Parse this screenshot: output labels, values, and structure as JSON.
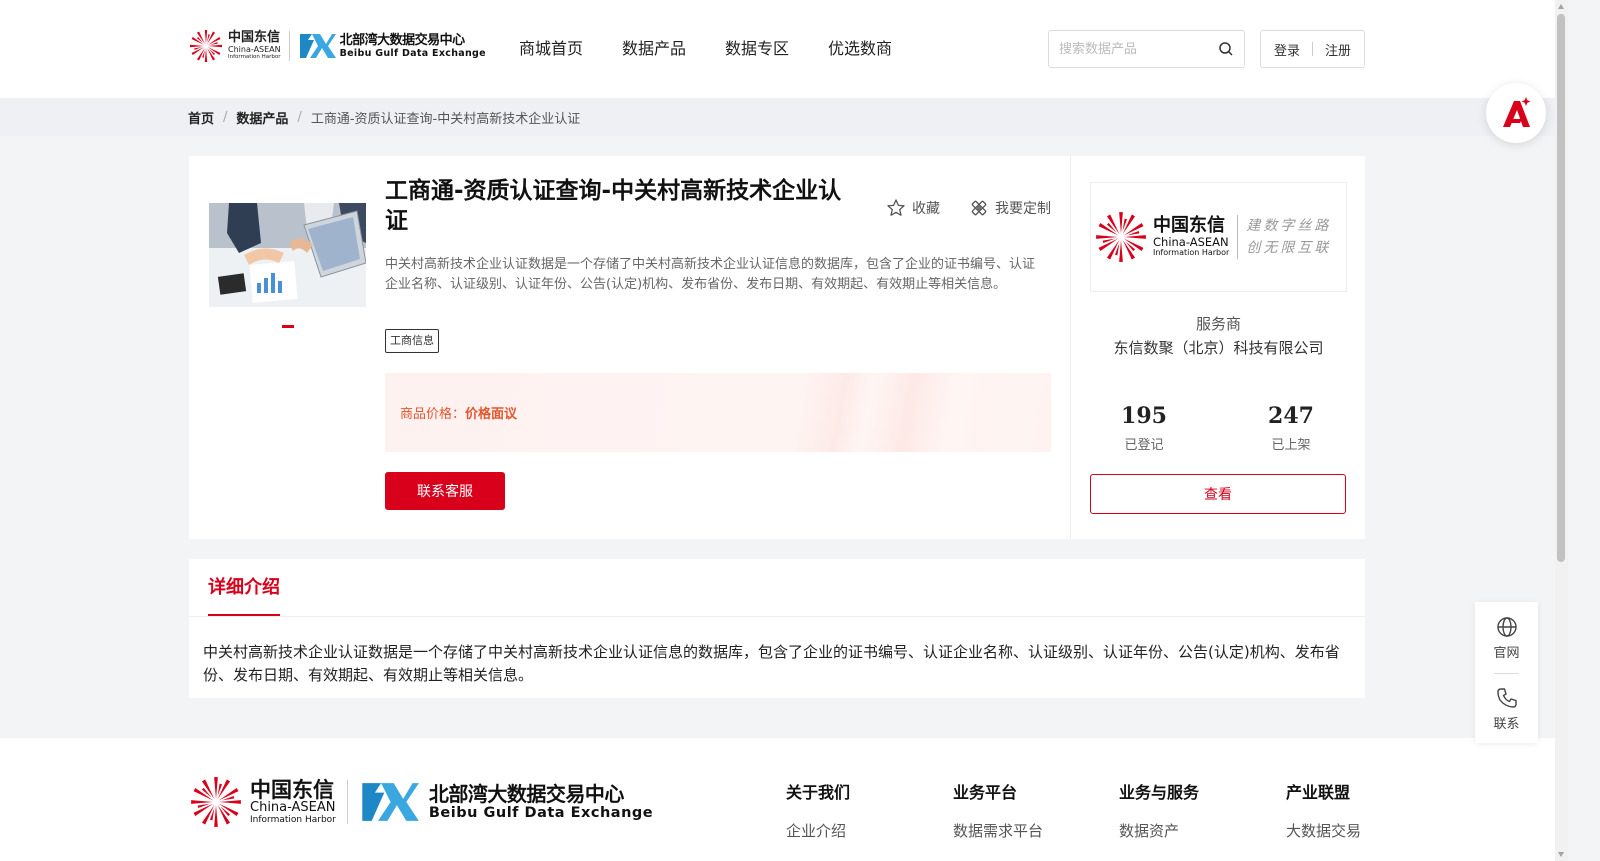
{
  "header": {
    "logo_ct": {
      "cn": "中国东信",
      "en1": "China-ASEAN",
      "en2": "Information Harbor"
    },
    "logo_bb": {
      "cn": "北部湾大数据交易中心",
      "en": "Beibu Gulf Data Exchange"
    },
    "nav": [
      "商城首页",
      "数据产品",
      "数据专区",
      "优选数商"
    ],
    "search_placeholder": "搜索数据产品",
    "login": "登录",
    "register": "注册"
  },
  "breadcrumb": {
    "home": "首页",
    "section": "数据产品",
    "current": "工商通-资质认证查询-中关村高新技术企业认证"
  },
  "product": {
    "title": "工商通-资质认证查询-中关村高新技术企业认证",
    "favorite": "收藏",
    "customize": "我要定制",
    "description": "中关村高新技术企业认证数据是一个存储了中关村高新技术企业认证信息的数据库，包含了企业的证书编号、认证企业名称、认证级别、认证年份、公告(认定)机构、发布省份、发布日期、有效期起、有效期止等相关信息。",
    "tag": "工商信息",
    "price_label": "商品价格：",
    "price_value": "价格面议",
    "contact_button": "联系客服"
  },
  "vendor": {
    "logo_cn": "中国东信",
    "logo_en1": "China-ASEAN",
    "logo_en2": "Information Harbor",
    "slogan1": "建数字丝路",
    "slogan2": "创无限互联",
    "label": "服务商",
    "name": "东信数聚（北京）科技有限公司",
    "stats": [
      {
        "num": "195",
        "label": "已登记"
      },
      {
        "num": "247",
        "label": "已上架"
      }
    ],
    "view_button": "查看"
  },
  "detail": {
    "tab": "详细介绍",
    "text": "中关村高新技术企业认证数据是一个存储了中关村高新技术企业认证信息的数据库，包含了企业的证书编号、认证企业名称、认证级别、认证年份、公告(认定)机构、发布省份、发布日期、有效期起、有效期止等相关信息。"
  },
  "footer": {
    "logo_ct": {
      "cn": "中国东信",
      "en1": "China-ASEAN",
      "en2": "Information Harbor"
    },
    "logo_bb": {
      "cn": "北部湾大数据交易中心",
      "en": "Beibu Gulf Data Exchange"
    },
    "columns": [
      {
        "title": "关于我们",
        "item": "企业介绍"
      },
      {
        "title": "业务平台",
        "item": "数据需求平台"
      },
      {
        "title": "业务与服务",
        "item": "数据资产"
      },
      {
        "title": "产业联盟",
        "item": "大数据交易"
      }
    ]
  },
  "float_panel": {
    "website": "官网",
    "contact": "联系"
  },
  "colors": {
    "brand_red": "#d9001b",
    "price_orange": "#e4572e",
    "logo_blue": "#1e88c7"
  }
}
